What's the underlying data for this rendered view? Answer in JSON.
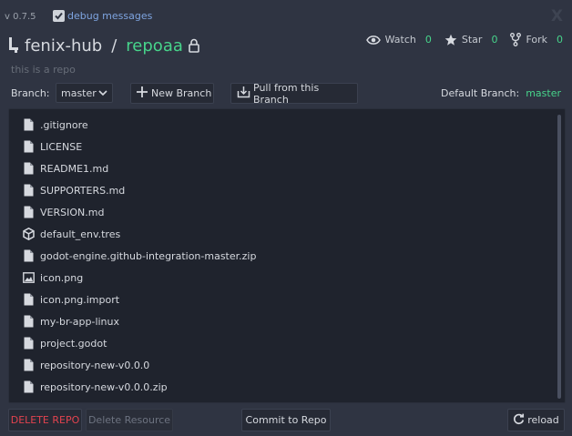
{
  "header": {
    "version": "v 0.7.5",
    "debug_label": "debug messages",
    "debug_checked": true,
    "close_label": "X"
  },
  "repo": {
    "owner": "fenix-hub",
    "separator": "/",
    "name": "repoaa",
    "description": "this is a repo",
    "private": true
  },
  "stats": {
    "watch_label": "Watch",
    "watch_count": "0",
    "star_label": "Star",
    "star_count": "0",
    "fork_label": "Fork",
    "fork_count": "0"
  },
  "branch": {
    "label": "Branch:",
    "selected": "master",
    "new_branch_label": "New Branch",
    "pull_label": "Pull from this Branch",
    "default_label": "Default Branch:",
    "default_value": "master"
  },
  "files": [
    {
      "name": ".gitignore",
      "icon": "file-icon"
    },
    {
      "name": "LICENSE",
      "icon": "file-icon"
    },
    {
      "name": "README1.md",
      "icon": "file-icon"
    },
    {
      "name": "SUPPORTERS.md",
      "icon": "file-icon"
    },
    {
      "name": "VERSION.md",
      "icon": "file-icon"
    },
    {
      "name": "default_env.tres",
      "icon": "resource-cube-icon"
    },
    {
      "name": "godot-engine.github-integration-master.zip",
      "icon": "file-icon"
    },
    {
      "name": "icon.png",
      "icon": "image-icon"
    },
    {
      "name": "icon.png.import",
      "icon": "file-icon"
    },
    {
      "name": "my-br-app-linux",
      "icon": "file-icon"
    },
    {
      "name": "project.godot",
      "icon": "file-icon"
    },
    {
      "name": "repository-new-v0.0.0",
      "icon": "file-icon"
    },
    {
      "name": "repository-new-v0.0.0.zip",
      "icon": "file-icon"
    }
  ],
  "footer": {
    "delete_repo_label": "DELETE REPO",
    "delete_resource_label": "Delete Resource",
    "commit_label": "Commit to Repo",
    "reload_label": "reload"
  },
  "colors": {
    "background": "#2f3442",
    "panel": "#1f232d",
    "accent_green": "#47d48b",
    "accent_blue": "#7ea4e0",
    "danger_red": "#e2434f"
  }
}
